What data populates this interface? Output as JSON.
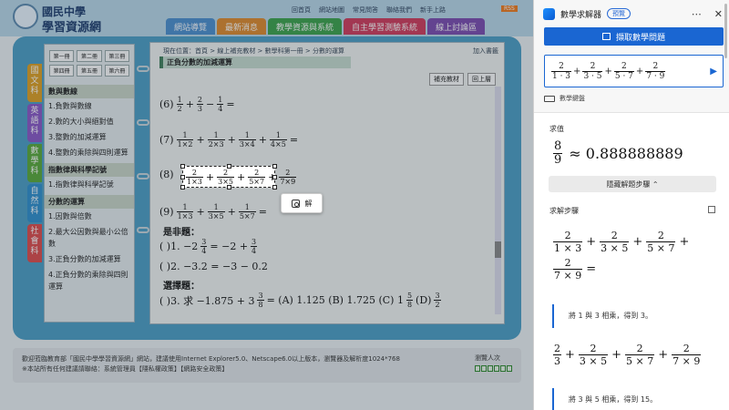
{
  "site": {
    "logo_line1": "國民中學",
    "logo_line2": "學習資源網",
    "top_links": [
      "回首頁",
      "網站地圖",
      "常見問答",
      "聯絡我們",
      "新手上路"
    ],
    "rss": "RSS",
    "nav_tabs": [
      {
        "label": "網站導覽",
        "color": "#4a8fd0"
      },
      {
        "label": "最新消息",
        "color": "#e08a2a"
      },
      {
        "label": "教學資源與系統",
        "color": "#3aa24a"
      },
      {
        "label": "自主學習測驗系統",
        "color": "#d23a5a"
      },
      {
        "label": "線上討論區",
        "color": "#7a4ab0"
      }
    ],
    "side_tabs": [
      {
        "label": "國文科",
        "color": "#e0a020"
      },
      {
        "label": "英語科",
        "color": "#8a56c8"
      },
      {
        "label": "數學科",
        "color": "#58aa38"
      },
      {
        "label": "自然科",
        "color": "#2d8fcf"
      },
      {
        "label": "社會科",
        "color": "#e04a4a"
      }
    ],
    "volume_buttons": [
      "第一冊",
      "第二冊",
      "第三冊",
      "第四冊",
      "第五冊",
      "第六冊"
    ],
    "sections": [
      {
        "title": "數與數線",
        "items": [
          "1.負數與數線",
          "2.數的大小與絕對值",
          "3.整數的加減運算",
          "4.整數的乘除與四則運算"
        ]
      },
      {
        "title": "指數律與科學記號",
        "items": [
          "1.指數律與科學記號"
        ]
      },
      {
        "title": "分數的運算",
        "items": [
          "1.因數與倍數",
          "2.最大公因數與最小公倍數",
          "3.正負分數的加減運算",
          "4.正負分數的乘除與四則運算"
        ]
      }
    ],
    "breadcrumb": "現在位置：首頁 > 線上補充教材 > 數學科第一冊 > 分數的運算",
    "favorite": "加入書籤",
    "lesson_title": "正負分數的加減運算",
    "supplement_btn": "補充教材",
    "prev_btn": "回上層",
    "problems": {
      "p6_label": "(6)",
      "p7_label": "(7)",
      "p8_label": "(8)",
      "p9_label": "(9)",
      "eq": "=",
      "plus": "+",
      "minus": "−"
    },
    "tf_heading": "是非題：",
    "tf1": "(    )1. −2",
    "tf1_rest": "= −2 +",
    "tf2": "(    )2. −3.2 = −3 − 0.2",
    "mc_heading": "選擇題：",
    "mc1": "(    )3. 求 −1.875 + 3",
    "mc1_rest": "= (A) 1.125  (B) 1.725  (C) 1",
    "mc1_d": "(D)",
    "solve_popup_label": "解",
    "footer_line1": "歡迎蒞臨教育部「國民中學學習資源網」網站，建議使用Internet Explorer5.0、Netscape6.0以上版本，瀏覽器及解析度1024*768",
    "footer_line2": "※本站所有任何建議請聯絡：系統管理員【隱私權政策】【網路安全政策】",
    "footer_counter": "瀏覽人次"
  },
  "panel": {
    "title": "數學求解器",
    "badge": "預覽",
    "pin_icon": "pin-icon",
    "close_icon": "close-icon",
    "capture_button": "擷取數學問題",
    "send_icon": "▶",
    "keyboard_label": "數學鍵盤",
    "result_label": "求值",
    "approx": "≈ 0.888888889",
    "hide_steps": "隱藏解題步驟 ⌃",
    "steps_label": "求解步驟",
    "step_note_1": "將 1 與 3 相乘，得到 3。",
    "step_note_2": "將 3 與 5 相乘，得到 15。"
  }
}
